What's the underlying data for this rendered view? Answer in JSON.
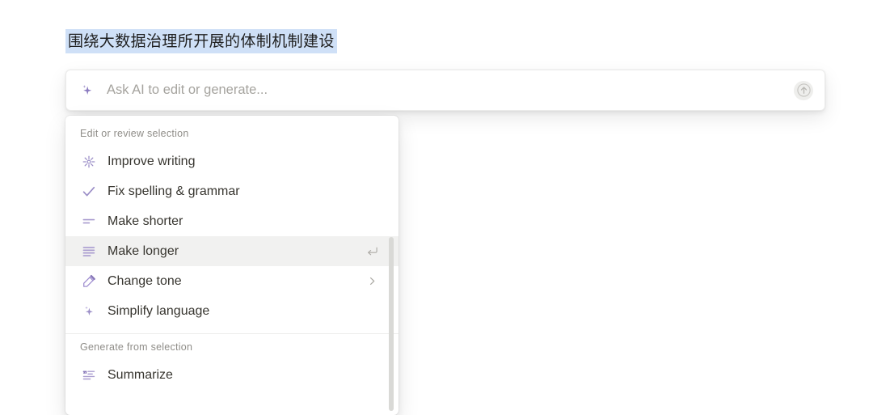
{
  "document": {
    "selected_text": "围绕大数据治理所开展的体制机制建设",
    "selection_highlight_color": "#cfe0f7"
  },
  "ai_bar": {
    "lead_icon": "sparkle-icon",
    "placeholder": "Ask AI to edit or generate...",
    "value": "",
    "submit_icon": "arrow-up-circle-icon"
  },
  "menu": {
    "sections": [
      {
        "title": "Edit or review selection",
        "items": [
          {
            "label": "Improve writing",
            "icon": "burst-sparkle-icon",
            "trailing": "",
            "active": false
          },
          {
            "label": "Fix spelling & grammar",
            "icon": "check-icon",
            "trailing": "",
            "active": false
          },
          {
            "label": "Make shorter",
            "icon": "short-lines-icon",
            "trailing": "",
            "active": false
          },
          {
            "label": "Make longer",
            "icon": "long-lines-icon",
            "trailing": "enter",
            "active": true
          },
          {
            "label": "Change tone",
            "icon": "pen-icon",
            "trailing": "chevron",
            "active": false
          },
          {
            "label": "Simplify language",
            "icon": "sparkle-icon",
            "trailing": "",
            "active": false
          }
        ]
      },
      {
        "title": "Generate from selection",
        "items": [
          {
            "label": "Summarize",
            "icon": "quote-lines-icon",
            "trailing": "",
            "active": false
          }
        ]
      }
    ],
    "accent_color": "#9b87c4",
    "hover_color": "#f1f1f0"
  }
}
